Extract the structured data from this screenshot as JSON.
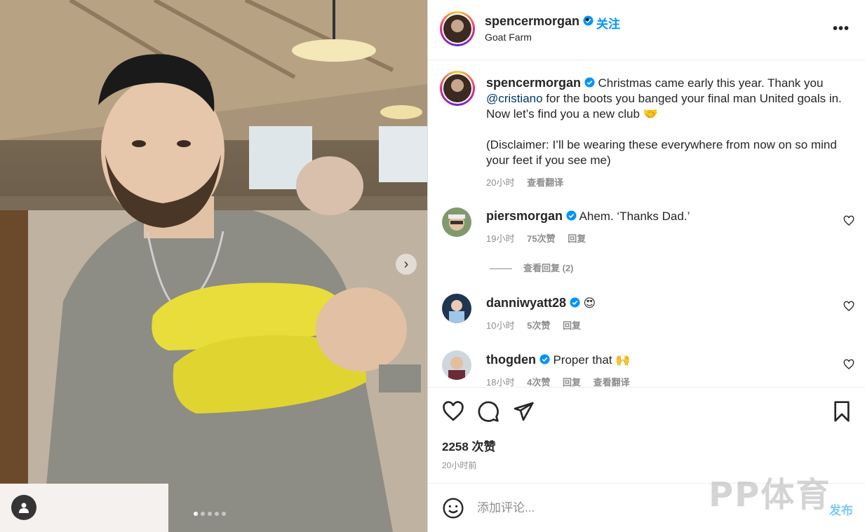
{
  "post": {
    "username": "spencermorgan",
    "follow_label": "关注",
    "separator": "•",
    "location": "Goat Farm",
    "more_label": "•••"
  },
  "caption": {
    "username": "spencermorgan",
    "text_before": " Christmas came early this year. Thank you ",
    "mention": "@cristiano",
    "text_after": " for the boots you banged your final man United goals in. Now let’s find you a new club 🤝",
    "disclaimer": "(Disclaimer: I’ll be wearing these everywhere from now on so mind your feet if you see me)",
    "time": "20小时",
    "translate": "查看翻译"
  },
  "comments": [
    {
      "username": "piersmorgan",
      "text": " Ahem. ‘Thanks Dad.’",
      "time": "19小时",
      "likes": "75次赞",
      "reply": "回复"
    },
    {
      "username": "danniwyatt28",
      "text": " 😍",
      "time": "10小时",
      "likes": "5次赞",
      "reply": "回复"
    },
    {
      "username": "thogden",
      "text": " Proper that 🙌",
      "time": "18小时",
      "likes": "4次赞",
      "reply": "回复",
      "translate": "查看翻译"
    }
  ],
  "view_replies": "查看回复 (2)",
  "likes_label": "2258 次赞",
  "posted_time": "20小时前",
  "add_comment": {
    "placeholder": "添加评论...",
    "post_label": "发布"
  },
  "watermark": "PP体育",
  "colors": {
    "accent": "#0095f6",
    "verified": "#0095f6",
    "text": "#262626",
    "muted": "#8e8e8e"
  }
}
